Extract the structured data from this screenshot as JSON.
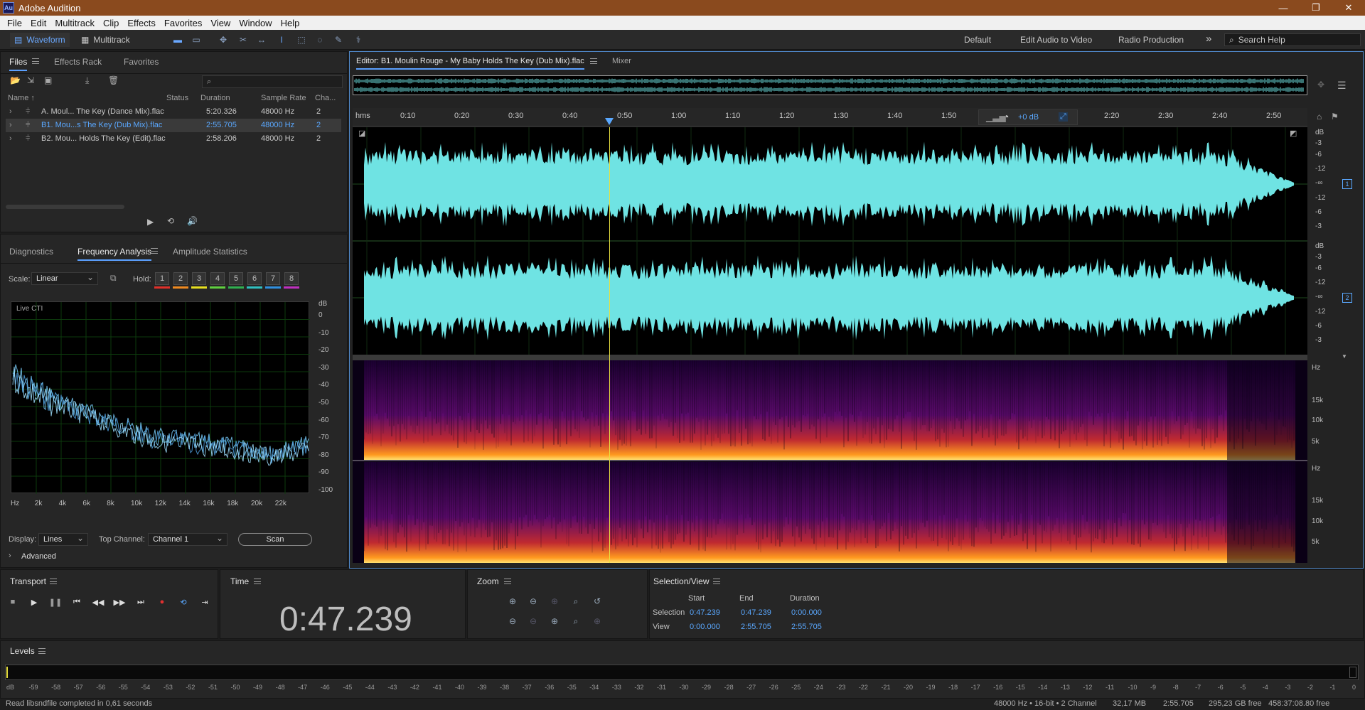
{
  "window": {
    "title": "Adobe Audition",
    "logo_text": "Au",
    "minimize": "—",
    "restore": "❐",
    "close": "✕"
  },
  "menu": [
    "File",
    "Edit",
    "Multitrack",
    "Clip",
    "Effects",
    "Favorites",
    "View",
    "Window",
    "Help"
  ],
  "toolbar": {
    "waveform_label": "Waveform",
    "multitrack_label": "Multitrack",
    "workspaces": [
      "Default",
      "Edit Audio to Video",
      "Radio Production"
    ],
    "more": "»",
    "search_placeholder": "Search Help"
  },
  "files_panel": {
    "tabs": [
      "Files",
      "Effects Rack",
      "Favorites"
    ],
    "search_placeholder": "",
    "columns": [
      "Name ↑",
      "Status",
      "Duration",
      "Sample Rate",
      "Cha..."
    ],
    "rows": [
      {
        "name": "A. Moul... The Key (Dance Mix).flac",
        "status": "",
        "duration": "5:20.326",
        "rate": "48000 Hz",
        "ch": "2",
        "selected": false
      },
      {
        "name": "B1. Mou...s The Key (Dub Mix).flac",
        "status": "",
        "duration": "2:55.705",
        "rate": "48000 Hz",
        "ch": "2",
        "selected": true
      },
      {
        "name": "B2. Mou... Holds The Key (Edit).flac",
        "status": "",
        "duration": "2:58.206",
        "rate": "48000 Hz",
        "ch": "2",
        "selected": false
      }
    ]
  },
  "analysis_panel": {
    "tabs": [
      "Diagnostics",
      "Frequency Analysis",
      "Amplitude Statistics"
    ],
    "scale_label": "Scale:",
    "scale_value": "Linear",
    "hold_label": "Hold:",
    "hold_buttons": [
      "1",
      "2",
      "3",
      "4",
      "5",
      "6",
      "7",
      "8"
    ],
    "hold_colors": [
      "#e0302a",
      "#f08a20",
      "#e8e020",
      "#60d040",
      "#30b050",
      "#30c0c0",
      "#3090e0",
      "#c030c0"
    ],
    "graph_label": "Live CTI",
    "db_unit": "dB",
    "db_ticks": [
      "0",
      "-10",
      "-20",
      "-30",
      "-40",
      "-50",
      "-60",
      "-70",
      "-80",
      "-90",
      "-100"
    ],
    "hz_ticks": [
      "Hz",
      "2k",
      "4k",
      "6k",
      "8k",
      "10k",
      "12k",
      "14k",
      "16k",
      "18k",
      "20k",
      "22k"
    ],
    "display_label": "Display:",
    "display_value": "Lines",
    "top_channel_label": "Top Channel:",
    "top_channel_value": "Channel 1",
    "scan_label": "Scan",
    "advanced_label": "Advanced"
  },
  "editor": {
    "tab_label": "Editor: B1. Moulin Rouge - My Baby Holds The Key (Dub Mix).flac",
    "mixer_label": "Mixer",
    "ruler": [
      "hms",
      "0:10",
      "0:20",
      "0:30",
      "0:40",
      "0:50",
      "1:00",
      "1:10",
      "1:20",
      "1:30",
      "1:40",
      "1:50",
      "2:20",
      "2:30",
      "2:40",
      "2:50"
    ],
    "gain_label": "+0 dB",
    "db_scale": [
      "dB",
      "-3",
      "-6",
      "-12",
      "-∞",
      "-12",
      "-6",
      "-3"
    ],
    "channel_badges": [
      "1",
      "2"
    ],
    "hz_scale": [
      "Hz",
      "15k",
      "10k",
      "5k"
    ],
    "waveform_color": "#6fe3e3",
    "playhead_color": "#e8e040"
  },
  "transport": {
    "title": "Transport"
  },
  "time": {
    "title": "Time",
    "value": "0:47.239"
  },
  "zoom": {
    "title": "Zoom"
  },
  "selection": {
    "title": "Selection/View",
    "headers": [
      "Start",
      "End",
      "Duration"
    ],
    "selection_label": "Selection",
    "view_label": "View",
    "selection": [
      "0:47.239",
      "0:47.239",
      "0:00.000"
    ],
    "view": [
      "0:00.000",
      "2:55.705",
      "2:55.705"
    ]
  },
  "levels": {
    "title": "Levels",
    "ticks": [
      "dB",
      "-59",
      "-58",
      "-57",
      "-56",
      "-55",
      "-54",
      "-53",
      "-52",
      "-51",
      "-50",
      "-49",
      "-48",
      "-47",
      "-46",
      "-45",
      "-44",
      "-43",
      "-42",
      "-41",
      "-40",
      "-39",
      "-38",
      "-37",
      "-36",
      "-35",
      "-34",
      "-33",
      "-32",
      "-31",
      "-30",
      "-29",
      "-28",
      "-27",
      "-26",
      "-25",
      "-24",
      "-23",
      "-22",
      "-21",
      "-20",
      "-19",
      "-18",
      "-17",
      "-16",
      "-15",
      "-14",
      "-13",
      "-12",
      "-11",
      "-10",
      "-9",
      "-8",
      "-7",
      "-6",
      "-5",
      "-4",
      "-3",
      "-2",
      "-1",
      "0"
    ]
  },
  "status": {
    "message": "Read libsndfile completed in 0,61 seconds",
    "format": "48000 Hz • 16-bit • 2 Channel",
    "size": "32,17 MB",
    "duration": "2:55.705",
    "free": "295,23 GB free",
    "time_free": "458:37:08.80 free"
  }
}
